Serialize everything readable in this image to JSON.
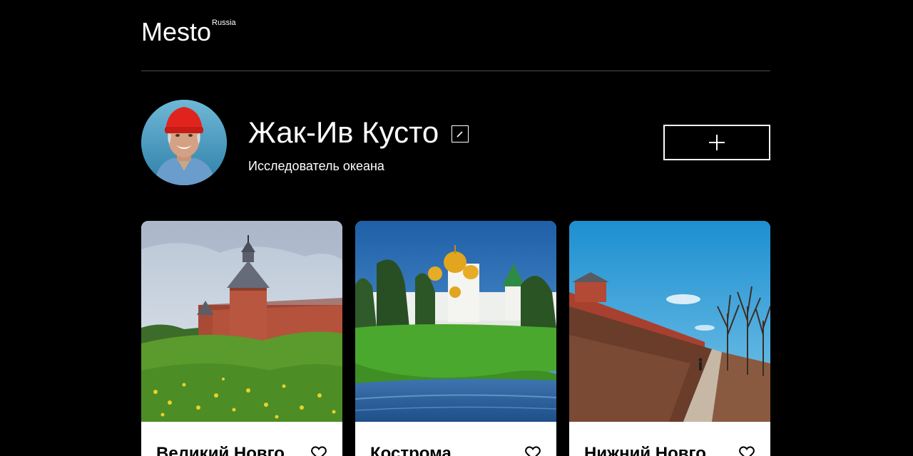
{
  "header": {
    "logo_word": "Mesto",
    "logo_region": "Russia"
  },
  "profile": {
    "name": "Жак-Ив Кусто",
    "about": "Исследователь океана",
    "edit_icon": "pencil-icon",
    "add_icon": "plus-icon"
  },
  "cards": [
    {
      "title": "Великий Новгород",
      "like_icon": "heart-outline-icon"
    },
    {
      "title": "Кострома",
      "like_icon": "heart-outline-icon"
    },
    {
      "title": "Нижний Новгород",
      "like_icon": "heart-outline-icon"
    }
  ],
  "colors": {
    "background": "#000000",
    "card": "#ffffff",
    "divider": "#545454"
  }
}
